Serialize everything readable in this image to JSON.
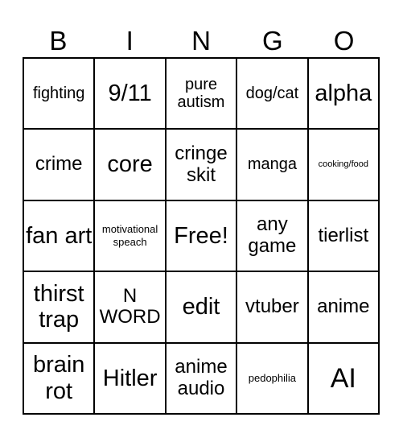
{
  "header": {
    "letters": [
      "B",
      "I",
      "N",
      "G",
      "O"
    ]
  },
  "cells": [
    {
      "text": "fighting",
      "size": "md"
    },
    {
      "text": "9/11",
      "size": "xl"
    },
    {
      "text": "pure autism",
      "size": "md"
    },
    {
      "text": "dog/cat",
      "size": "md"
    },
    {
      "text": "alpha",
      "size": "xl"
    },
    {
      "text": "crime",
      "size": "lg"
    },
    {
      "text": "core",
      "size": "xl"
    },
    {
      "text": "cringe skit",
      "size": "lg"
    },
    {
      "text": "manga",
      "size": "md"
    },
    {
      "text": "cooking/food",
      "size": "xs"
    },
    {
      "text": "fan art",
      "size": "xl"
    },
    {
      "text": "motivational speach",
      "size": "sm"
    },
    {
      "text": "Free!",
      "size": "xl"
    },
    {
      "text": "any game",
      "size": "lg"
    },
    {
      "text": "tierlist",
      "size": "lg"
    },
    {
      "text": "thirst trap",
      "size": "xl"
    },
    {
      "text": "N WORD",
      "size": "lg"
    },
    {
      "text": "edit",
      "size": "xl"
    },
    {
      "text": "vtuber",
      "size": "lg"
    },
    {
      "text": "anime",
      "size": "lg"
    },
    {
      "text": "brain rot",
      "size": "xl"
    },
    {
      "text": "Hitler",
      "size": "xl"
    },
    {
      "text": "anime audio",
      "size": "lg"
    },
    {
      "text": "pedophilia",
      "size": "sm"
    },
    {
      "text": "AI",
      "size": "xxl"
    }
  ]
}
